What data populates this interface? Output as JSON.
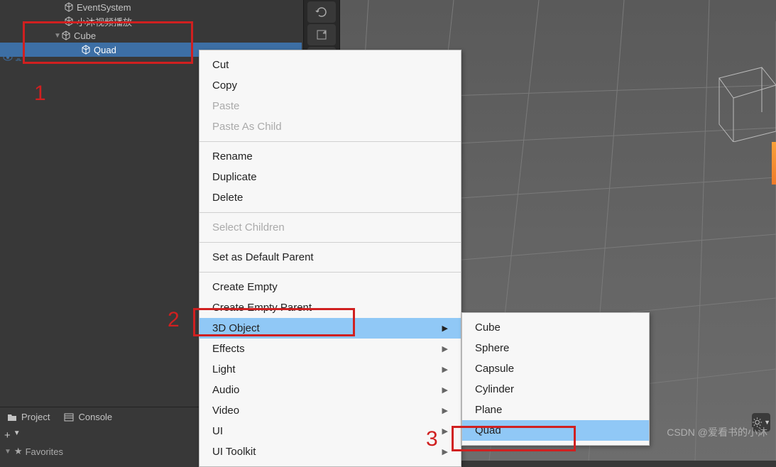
{
  "hierarchy": {
    "items": [
      {
        "label": "EventSystem",
        "indent": 90
      },
      {
        "label": "小沐视频播放",
        "indent": 90
      },
      {
        "label": "Cube",
        "indent": 90,
        "arrow": true
      },
      {
        "label": "Quad",
        "indent": 114,
        "selected": true
      }
    ]
  },
  "bottom": {
    "project": "Project",
    "console": "Console",
    "plus": "+",
    "favorites": "Favorites"
  },
  "annotations": {
    "label1": "1",
    "label2": "2",
    "label3": "3"
  },
  "context_menu": {
    "groups": [
      [
        {
          "label": "Cut"
        },
        {
          "label": "Copy"
        },
        {
          "label": "Paste",
          "disabled": true
        },
        {
          "label": "Paste As Child",
          "disabled": true
        }
      ],
      [
        {
          "label": "Rename"
        },
        {
          "label": "Duplicate"
        },
        {
          "label": "Delete"
        }
      ],
      [
        {
          "label": "Select Children",
          "disabled": true
        }
      ],
      [
        {
          "label": "Set as Default Parent"
        }
      ],
      [
        {
          "label": "Create Empty"
        },
        {
          "label": "Create Empty Parent"
        },
        {
          "label": "3D Object",
          "submenu": true,
          "hover": true
        },
        {
          "label": "Effects",
          "submenu": true
        },
        {
          "label": "Light",
          "submenu": true
        },
        {
          "label": "Audio",
          "submenu": true
        },
        {
          "label": "Video",
          "submenu": true
        },
        {
          "label": "UI",
          "submenu": true
        },
        {
          "label": "UI Toolkit",
          "submenu": true
        }
      ]
    ]
  },
  "submenu": {
    "items": [
      {
        "label": "Cube"
      },
      {
        "label": "Sphere"
      },
      {
        "label": "Capsule"
      },
      {
        "label": "Cylinder"
      },
      {
        "label": "Plane"
      },
      {
        "label": "Quad",
        "hover": true
      }
    ]
  },
  "watermark": "CSDN @爱看书的小沐"
}
